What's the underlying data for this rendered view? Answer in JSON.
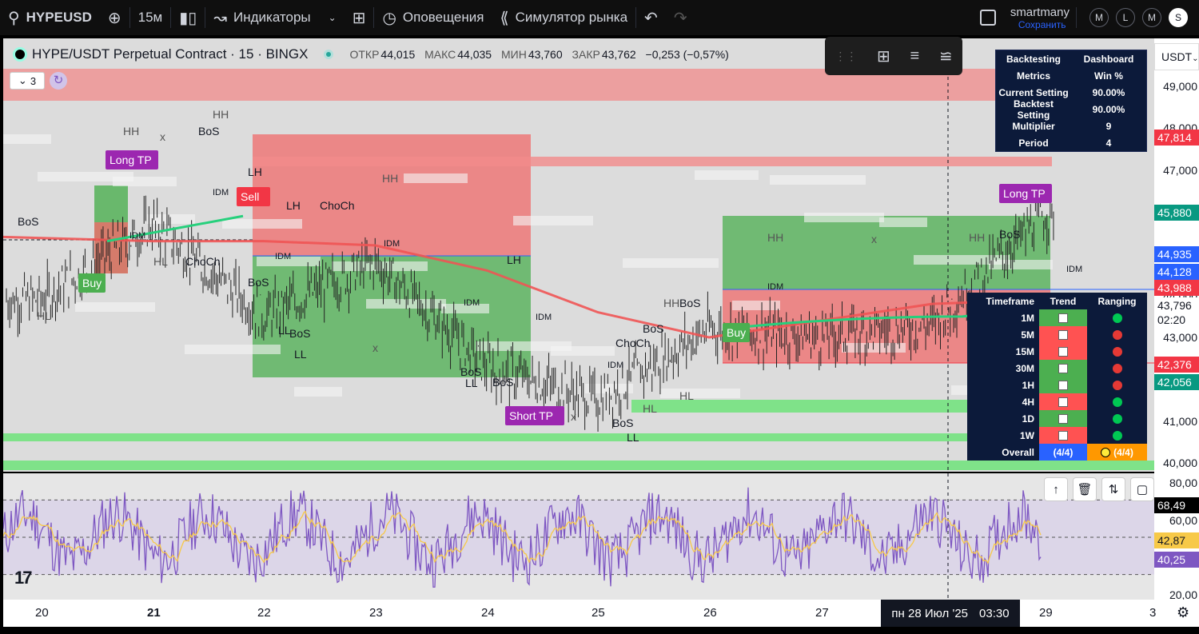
{
  "toolbar": {
    "symbol": "HYPEUSD",
    "interval": "15м",
    "indicators": "Индикаторы",
    "alerts": "Оповещения",
    "simulator": "Симулятор рынка",
    "user": "smartmany",
    "save": "Сохранить",
    "buttons": [
      "M",
      "L",
      "M",
      "S"
    ]
  },
  "legend": {
    "title": "HYPE/USDT Perpetual Contract · 15 · BINGX",
    "open_label": "ОТКР",
    "open": "44,015",
    "high_label": "МАКС",
    "high": "44,035",
    "low_label": "МИН",
    "low": "43,760",
    "close_label": "ЗАКР",
    "close": "43,762",
    "change": "−0,253 (−0,57%)",
    "indicator_count": "3"
  },
  "currency": "USDT",
  "price_axis": {
    "ticks": [
      "49,000",
      "48,000",
      "47,000",
      "46,000",
      "45,000",
      "44,000",
      "43,000",
      "42,000",
      "41,000",
      "40,000"
    ],
    "tags": [
      {
        "value": "47,814",
        "color": "#f23645"
      },
      {
        "value": "45,880",
        "color": "#089981"
      },
      {
        "value": "44,935",
        "color": "#2962ff"
      },
      {
        "value": "44,128",
        "color": "#2962ff"
      },
      {
        "value": "43,988",
        "color": "#f23645"
      },
      {
        "value": "43,796",
        "color": "#ffffff"
      },
      {
        "value": "02:20",
        "color": "#ffffff"
      },
      {
        "value": "42,376",
        "color": "#f23645"
      },
      {
        "value": "42,056",
        "color": "#089981"
      }
    ]
  },
  "rsi_axis": {
    "ticks": [
      "80,00",
      "60,00",
      "40,00",
      "20,00"
    ],
    "tags": [
      {
        "value": "68,49",
        "color": "#000000"
      },
      {
        "value": "42,87",
        "color": "#f7c948"
      },
      {
        "value": "40,25",
        "color": "#7e57c2"
      }
    ]
  },
  "time_axis": {
    "labels": [
      "20",
      "21",
      "22",
      "23",
      "24",
      "25",
      "26",
      "27",
      "29",
      "3"
    ],
    "crosshair": "пн 28 Июл '25",
    "crosshair_time": "03:30"
  },
  "backtest": {
    "header": [
      "Backtesting",
      "Dashboard"
    ],
    "rows": [
      [
        "Metrics",
        "Win %"
      ],
      [
        "Current Setting",
        "90.00%"
      ],
      [
        "Backtest Setting",
        "90.00%"
      ],
      [
        "Multiplier",
        "9"
      ],
      [
        "Period",
        "4"
      ]
    ]
  },
  "timeframe_table": {
    "header": [
      "Timeframe",
      "Trend",
      "Ranging"
    ],
    "rows": [
      {
        "tf": "1M",
        "trend": "#4caf50",
        "dot": "#00c853"
      },
      {
        "tf": "5M",
        "trend": "#ff5252",
        "dot": "#e53935"
      },
      {
        "tf": "15M",
        "trend": "#ff5252",
        "dot": "#e53935"
      },
      {
        "tf": "30M",
        "trend": "#4caf50",
        "dot": "#e53935"
      },
      {
        "tf": "1H",
        "trend": "#4caf50",
        "dot": "#e53935"
      },
      {
        "tf": "4H",
        "trend": "#ff5252",
        "dot": "#00c853"
      },
      {
        "tf": "1D",
        "trend": "#4caf50",
        "dot": "#00c853"
      },
      {
        "tf": "1W",
        "trend": "#ff5252",
        "dot": "#00c853"
      }
    ],
    "overall": {
      "label": "Overall",
      "trend": "(4/4)",
      "ranging": "(4/4)"
    }
  },
  "chart_annotations": [
    {
      "text": "BoS"
    },
    {
      "text": "HH"
    },
    {
      "text": "HL"
    },
    {
      "text": "ChoCh"
    },
    {
      "text": "LL"
    },
    {
      "text": "IDM"
    },
    {
      "text": "LH"
    },
    {
      "text": "x"
    }
  ],
  "signals": [
    {
      "text": "Buy",
      "color": "#4caf50"
    },
    {
      "text": "Sell",
      "color": "#f23645"
    },
    {
      "text": "Long TP",
      "color": "#9c27b0"
    },
    {
      "text": "Short TP",
      "color": "#9c27b0"
    }
  ],
  "chart_data": {
    "type": "line",
    "title": "HYPE/USDT Perpetual Contract · 15 · BINGX",
    "xlabel": "",
    "ylabel": "",
    "ylim": [
      40000,
      49000
    ],
    "categories": [
      "20",
      "21",
      "22",
      "23",
      "24",
      "25",
      "26",
      "27",
      "28",
      "29"
    ],
    "series": [
      {
        "values": [
          43900,
          45700,
          43500,
          44800,
          42300,
          41500,
          43200,
          43000,
          43300,
          45900
        ]
      },
      {
        "values": [
          45400,
          45300,
          45300,
          45200,
          44600,
          43600,
          43000,
          43400,
          43800,
          43900
        ]
      }
    ],
    "rsi": {
      "ylim": [
        20,
        80
      ],
      "ticks": [
        80,
        60,
        40,
        20
      ],
      "last": [
        68.49,
        42.87,
        40.25
      ]
    }
  }
}
